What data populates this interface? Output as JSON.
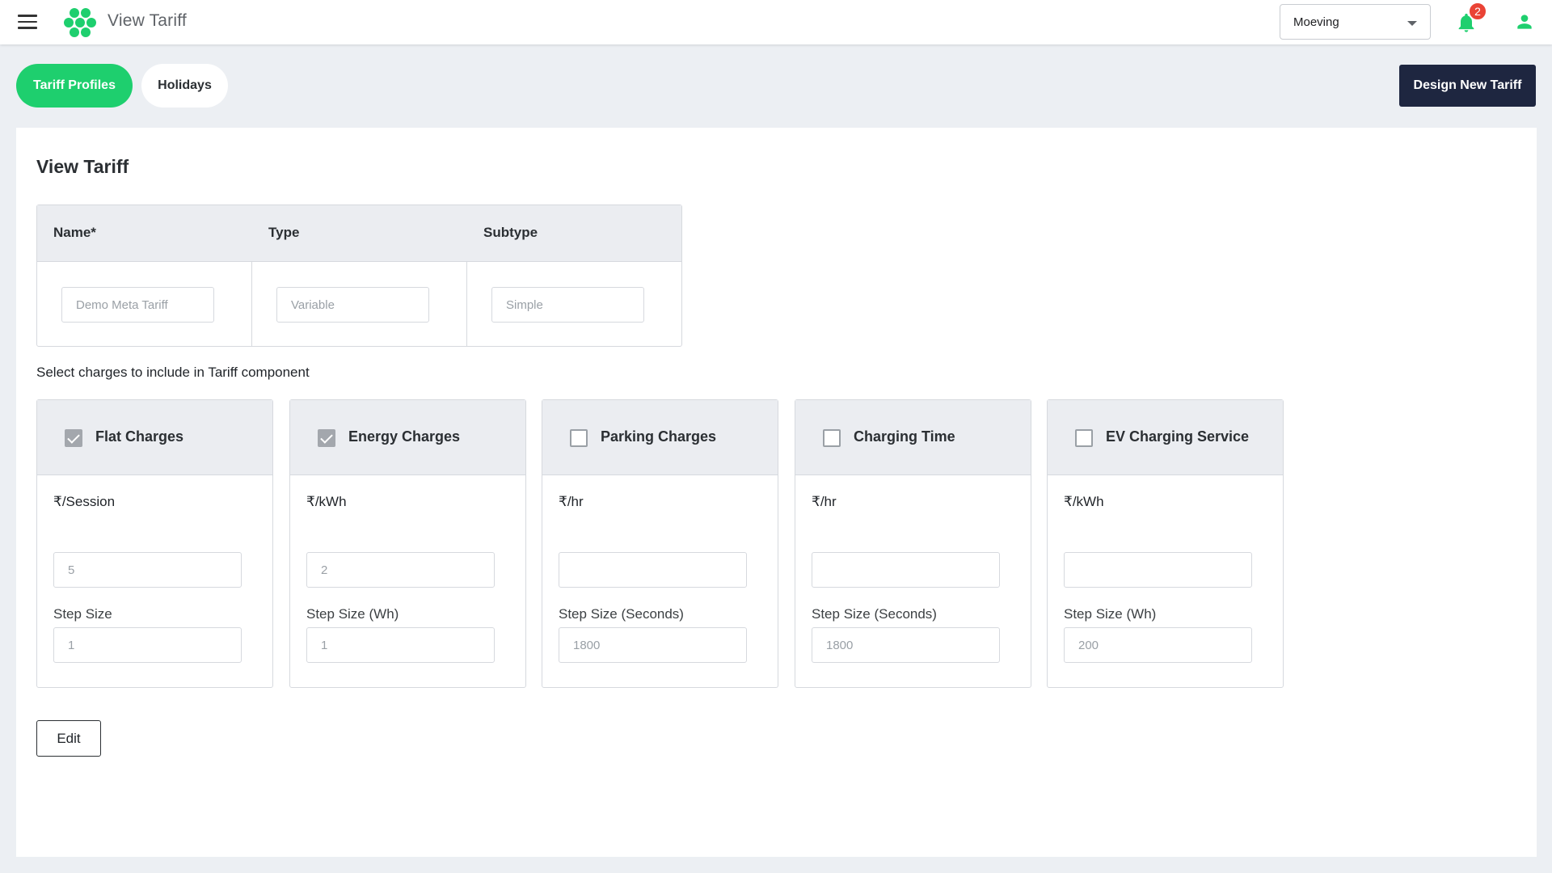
{
  "header": {
    "title": "View Tariff",
    "org_select": "Moeving",
    "notification_count": "2",
    "brand_color": "#1ecf6e"
  },
  "tabs": [
    {
      "label": "Tariff Profiles",
      "active": true
    },
    {
      "label": "Holidays",
      "active": false
    }
  ],
  "design_button": "Design New Tariff",
  "main": {
    "title": "View Tariff",
    "columns": [
      {
        "header": "Name*",
        "value": "Demo Meta Tariff"
      },
      {
        "header": "Type",
        "value": "Variable"
      },
      {
        "header": "Subtype",
        "value": "Simple"
      }
    ],
    "charges_label": "Select charges to include in Tariff component",
    "charges": [
      {
        "title": "Flat Charges",
        "checked": true,
        "unit": "₹/Session",
        "rate": "5",
        "step_label": "Step Size",
        "step": "1"
      },
      {
        "title": "Energy Charges",
        "checked": true,
        "unit": "₹/kWh",
        "rate": "2",
        "step_label": "Step Size (Wh)",
        "step": "1"
      },
      {
        "title": "Parking Charges",
        "checked": false,
        "unit": "₹/hr",
        "rate": "",
        "step_label": "Step Size (Seconds)",
        "step": "1800"
      },
      {
        "title": "Charging Time",
        "checked": false,
        "unit": "₹/hr",
        "rate": "",
        "step_label": "Step Size (Seconds)",
        "step": "1800"
      },
      {
        "title": "EV Charging Service",
        "checked": false,
        "unit": "₹/kWh",
        "rate": "",
        "step_label": "Step Size (Wh)",
        "step": "200"
      }
    ],
    "edit_button": "Edit"
  }
}
